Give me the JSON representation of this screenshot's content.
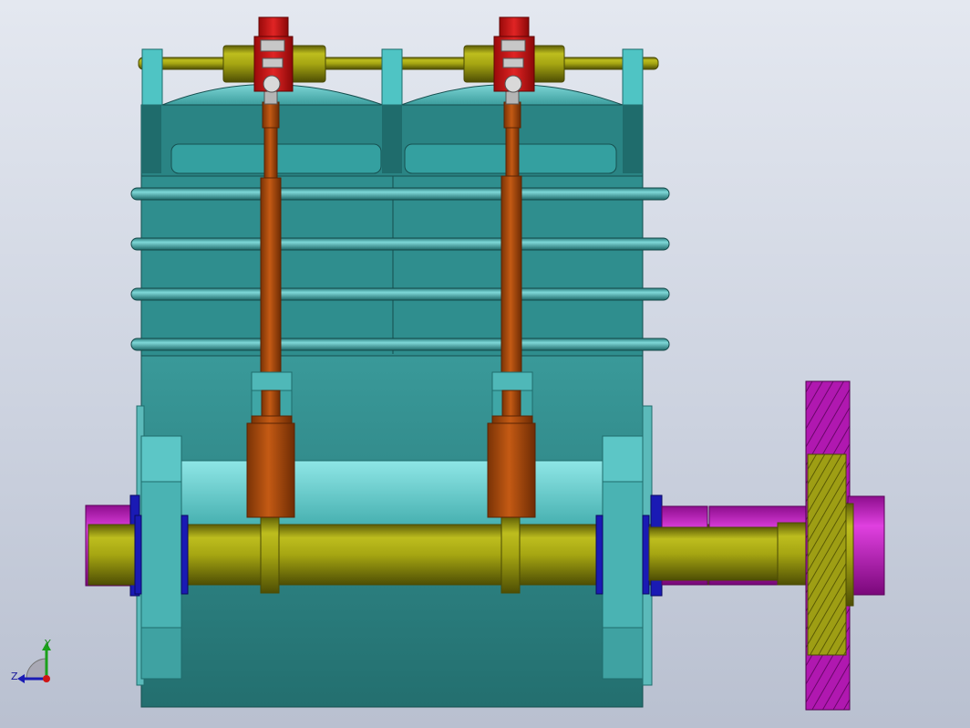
{
  "view": {
    "background_top": "#e4e8f0",
    "background_bottom": "#b9c0d0"
  },
  "colors": {
    "casing": "#2f8e8e",
    "casing_dark": "#1f6c6c",
    "casing_light": "#5bbaba",
    "bracket": "#4fc4c4",
    "shaft": "#a6a612",
    "shaft_dark": "#6e6e08",
    "rod": "#b24e0e",
    "rod_dark": "#7a3306",
    "valve": "#cc1414",
    "bearing_ring": "#1a1ab4",
    "hub": "#c418c4",
    "gear": "#b018b0"
  },
  "triad": {
    "icon": "view-orientation-triad-icon",
    "y_axis_label": "Y",
    "z_axis_label": "Z"
  }
}
